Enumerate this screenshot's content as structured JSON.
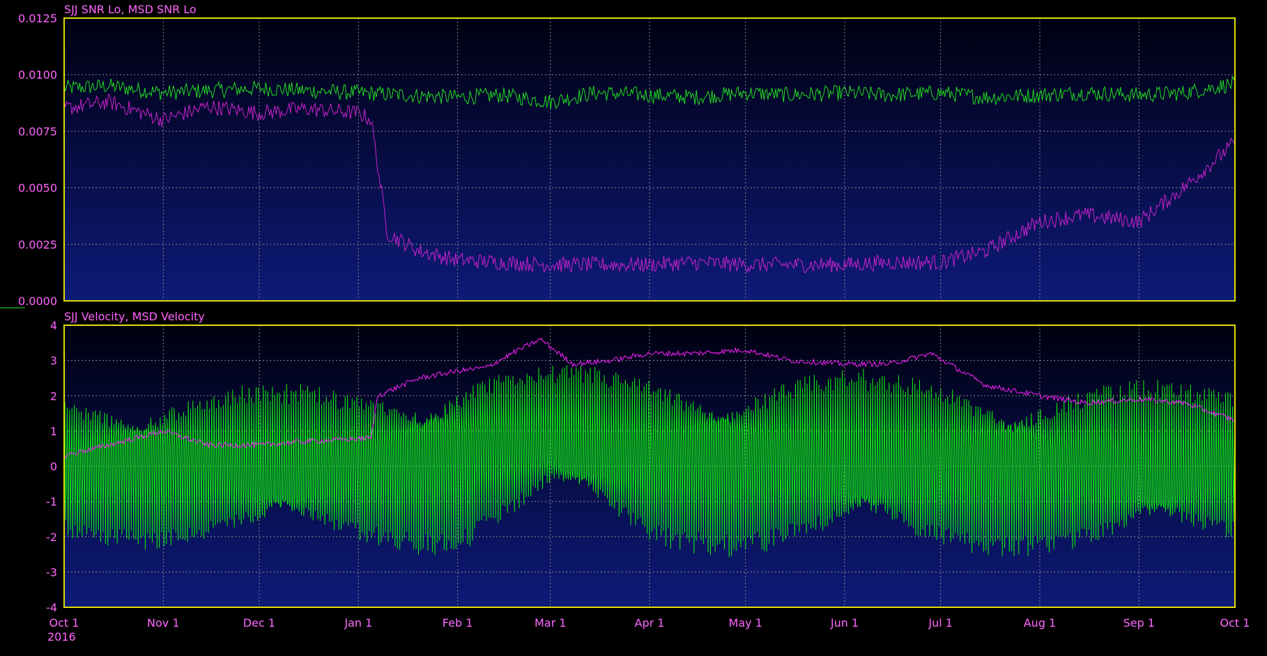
{
  "chart_data": [
    {
      "type": "line",
      "title": "SJJ SNR Lo, MSD SNR Lo",
      "x_range": [
        "2015-10-01",
        "2016-10-01"
      ],
      "ylim": [
        0,
        0.0125
      ],
      "y_ticks": [
        "0.0000",
        "0.0025",
        "0.0050",
        "0.0075",
        "0.0100",
        "0.0125"
      ],
      "grid": true,
      "series": [
        {
          "name": "SJJ SNR Lo",
          "color": "#22dd22",
          "x": [
            "2015-10-01",
            "2015-10-15",
            "2015-11-01",
            "2015-11-15",
            "2015-12-01",
            "2015-12-15",
            "2016-01-01",
            "2016-01-15",
            "2016-02-01",
            "2016-02-15",
            "2016-03-01",
            "2016-03-15",
            "2016-04-01",
            "2016-04-15",
            "2016-05-01",
            "2016-05-15",
            "2016-06-01",
            "2016-06-15",
            "2016-07-01",
            "2016-07-15",
            "2016-08-01",
            "2016-08-15",
            "2016-09-01",
            "2016-09-15",
            "2016-10-01"
          ],
          "values": [
            0.0094,
            0.0095,
            0.0092,
            0.0093,
            0.0094,
            0.0093,
            0.0092,
            0.0091,
            0.009,
            0.0091,
            0.0088,
            0.0092,
            0.0091,
            0.009,
            0.0092,
            0.0091,
            0.0092,
            0.0091,
            0.0092,
            0.009,
            0.0091,
            0.0092,
            0.0091,
            0.0092,
            0.0096
          ]
        },
        {
          "name": "MSD SNR Lo",
          "color": "#cc22cc",
          "x": [
            "2015-10-01",
            "2015-10-15",
            "2015-11-01",
            "2015-11-15",
            "2015-12-01",
            "2015-12-15",
            "2016-01-01",
            "2016-01-05",
            "2016-01-10",
            "2016-01-20",
            "2016-02-01",
            "2016-02-15",
            "2016-03-01",
            "2016-03-15",
            "2016-04-01",
            "2016-04-15",
            "2016-05-01",
            "2016-05-15",
            "2016-06-01",
            "2016-06-15",
            "2016-07-01",
            "2016-07-15",
            "2016-08-01",
            "2016-08-15",
            "2016-09-01",
            "2016-09-15",
            "2016-10-01"
          ],
          "values": [
            0.0085,
            0.0088,
            0.008,
            0.0086,
            0.0083,
            0.0085,
            0.0083,
            0.008,
            0.003,
            0.0022,
            0.0018,
            0.0017,
            0.0016,
            0.0016,
            0.0016,
            0.0017,
            0.0016,
            0.0016,
            0.0016,
            0.0017,
            0.0017,
            0.0022,
            0.0035,
            0.0038,
            0.0035,
            0.005,
            0.007
          ]
        }
      ]
    },
    {
      "type": "line",
      "title": "SJJ Velocity, MSD Velocity",
      "x_range": [
        "2015-10-01",
        "2016-10-01"
      ],
      "ylim": [
        -4,
        4
      ],
      "y_ticks": [
        "-4",
        "-3",
        "-2",
        "-1",
        "0",
        "1",
        "2",
        "3",
        "4"
      ],
      "grid": true,
      "series": [
        {
          "name": "SJJ Velocity",
          "color": "#11ee11",
          "style": "oscillating band",
          "x": [
            "2015-10-01",
            "2015-11-01",
            "2015-12-01",
            "2016-01-01",
            "2016-02-01",
            "2016-03-01",
            "2016-04-01",
            "2016-05-01",
            "2016-06-01",
            "2016-07-01",
            "2016-08-01",
            "2016-09-01",
            "2016-10-01"
          ],
          "upper": [
            2.2,
            2.4,
            2.4,
            2.3,
            3.0,
            2.9,
            2.8,
            2.8,
            2.8,
            2.7,
            2.5,
            2.5,
            2.4
          ],
          "lower": [
            -2.3,
            -2.4,
            -2.4,
            -2.4,
            -2.6,
            -1.2,
            -2.5,
            -2.6,
            -2.5,
            -2.6,
            -2.6,
            -2.6,
            -2.4
          ]
        },
        {
          "name": "MSD Velocity",
          "color": "#ff22ff",
          "x": [
            "2015-10-01",
            "2015-10-15",
            "2015-11-01",
            "2015-11-15",
            "2015-12-01",
            "2015-12-15",
            "2016-01-05",
            "2016-01-07",
            "2016-01-20",
            "2016-02-01",
            "2016-02-10",
            "2016-02-20",
            "2016-02-27",
            "2016-03-08",
            "2016-03-20",
            "2016-04-01",
            "2016-04-15",
            "2016-05-01",
            "2016-05-15",
            "2016-06-01",
            "2016-06-15",
            "2016-06-28",
            "2016-07-15",
            "2016-08-01",
            "2016-08-15",
            "2016-09-01",
            "2016-09-15",
            "2016-10-01"
          ],
          "values": [
            0.3,
            0.6,
            1.0,
            0.6,
            0.6,
            0.7,
            0.8,
            2.0,
            2.5,
            2.7,
            2.8,
            3.3,
            3.6,
            2.9,
            3.0,
            3.2,
            3.2,
            3.3,
            3.0,
            2.9,
            2.9,
            3.2,
            2.3,
            2.0,
            1.8,
            1.9,
            1.8,
            1.3
          ]
        }
      ]
    }
  ],
  "x_axis": {
    "tick_labels": [
      "Oct 1",
      "Nov 1",
      "Dec 1",
      "Jan 1",
      "Feb 1",
      "Mar 1",
      "Apr 1",
      "May 1",
      "Jun 1",
      "Jul 1",
      "Aug 1",
      "Sep 1",
      "Oct 1"
    ],
    "tick_dates": [
      "2015-10-01",
      "2015-11-01",
      "2015-12-01",
      "2016-01-01",
      "2016-02-01",
      "2016-03-01",
      "2016-04-01",
      "2016-05-01",
      "2016-06-01",
      "2016-07-01",
      "2016-08-01",
      "2016-09-01",
      "2016-10-01"
    ],
    "year_label": "2016"
  }
}
